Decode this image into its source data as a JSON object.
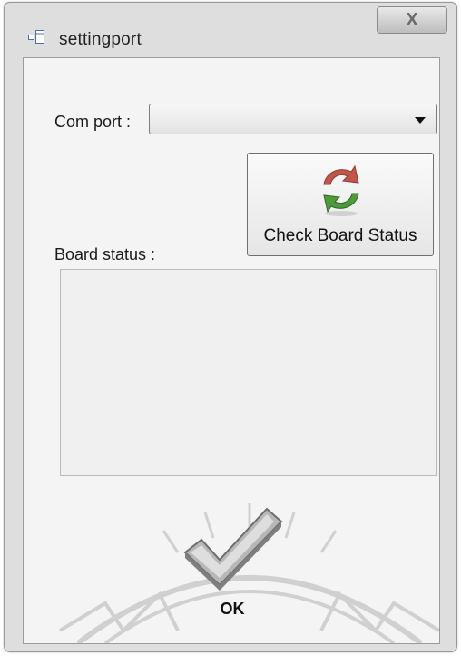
{
  "window": {
    "title": "settingport",
    "close_glyph": "X"
  },
  "com_port": {
    "label": "Com port :",
    "value": ""
  },
  "check_board": {
    "label": "Check Board Status",
    "icon": "refresh-arrows-icon"
  },
  "board_status": {
    "label": "Board status :",
    "text": ""
  },
  "ok": {
    "label": "OK",
    "icon": "checkmark-icon"
  },
  "colors": {
    "window_bg": "#dedede",
    "client_bg": "#f4f4f4",
    "refresh_green": "#4e9a3c",
    "refresh_red": "#c0574a"
  }
}
